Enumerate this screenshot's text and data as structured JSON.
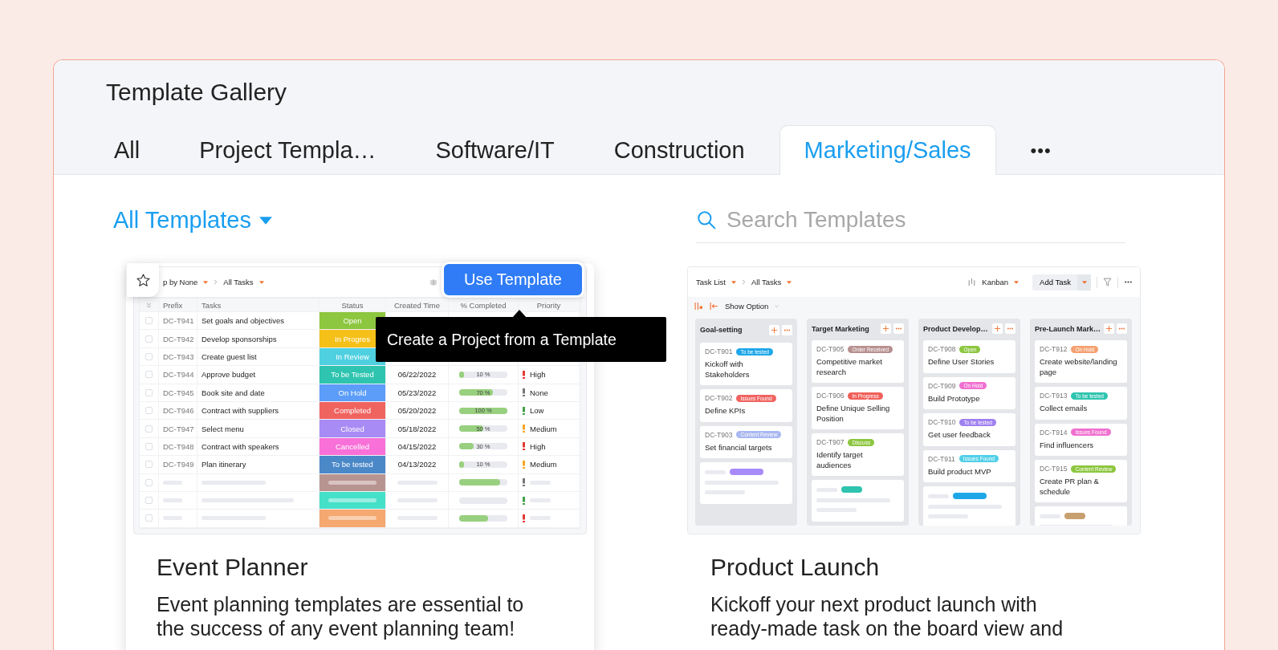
{
  "page_title": "Template Gallery",
  "tabs": [
    {
      "label": "All",
      "selected": false
    },
    {
      "label": "Project Templa…",
      "selected": false
    },
    {
      "label": "Software/IT",
      "selected": false
    },
    {
      "label": "Construction",
      "selected": false
    },
    {
      "label": "Marketing/Sales",
      "selected": true
    },
    {
      "label": "•••",
      "selected": false
    }
  ],
  "filter": {
    "label": "All Templates"
  },
  "search": {
    "placeholder": "Search Templates"
  },
  "templates": [
    {
      "kind": "table",
      "hovered": true,
      "title": "Event Planner",
      "description": "Event planning templates are essential to the success of any event planning team!",
      "use_button": "Use Template",
      "tooltip": "Create a Project from a Template",
      "preview": {
        "breadcrumb": [
          "p by None",
          "All Tasks"
        ],
        "columns": [
          "Prefix",
          "Tasks",
          "Status",
          "Created Time",
          "% Completed",
          "Priority"
        ],
        "rows": [
          {
            "kind": "task",
            "checked": false,
            "prefix": "DC-T941",
            "task": "Set goals and objectives",
            "status": {
              "label": "Open",
              "color": "#8dc63f"
            }
          },
          {
            "kind": "task",
            "checked": false,
            "prefix": "DC-T942",
            "task": "Develop sponsorships",
            "status": {
              "label": "In Progres",
              "color": "#f5c018"
            }
          },
          {
            "kind": "task",
            "checked": false,
            "prefix": "DC-T943",
            "task": "Create guest list",
            "status": {
              "label": "In Review",
              "color": "#4fd0e0"
            }
          },
          {
            "kind": "task",
            "checked": false,
            "prefix": "DC-T944",
            "task": "Approve budget",
            "status": {
              "label": "To be Tested",
              "color": "#2ec4b0"
            },
            "created": "06/22/2022",
            "progress": {
              "label": "10 %",
              "level": 0.1
            },
            "priority": {
              "label": "High",
              "color": "#e53935"
            }
          },
          {
            "kind": "task",
            "checked": false,
            "prefix": "DC-T945",
            "task": "Book site and date",
            "status": {
              "label": "On Hold",
              "color": "#5b9df9"
            },
            "created": "05/23/2022",
            "progress": {
              "label": "70 %",
              "level": 0.7
            },
            "priority": {
              "label": "None",
              "color": "#777777"
            }
          },
          {
            "kind": "task",
            "checked": false,
            "prefix": "DC-T946",
            "task": "Contract with suppliers",
            "status": {
              "label": "Completed",
              "color": "#f06460"
            },
            "created": "05/20/2022",
            "progress": {
              "label": "100 %",
              "level": 1
            },
            "priority": {
              "label": "Low",
              "color": "#43a047"
            }
          },
          {
            "kind": "task",
            "checked": false,
            "prefix": "DC-T947",
            "task": "Select menu",
            "status": {
              "label": "Closed",
              "color": "#a98bf5"
            },
            "created": "05/18/2022",
            "progress": {
              "label": "50 %",
              "level": 0.5
            },
            "priority": {
              "label": "Medium",
              "color": "#f5a623"
            }
          },
          {
            "kind": "task",
            "checked": false,
            "prefix": "DC-T948",
            "task": "Contract with speakers",
            "status": {
              "label": "Cancelled",
              "color": "#f870d8"
            },
            "created": "04/15/2022",
            "progress": {
              "label": "30 %",
              "level": 0.3
            },
            "priority": {
              "label": "High",
              "color": "#e53935"
            }
          },
          {
            "kind": "task",
            "checked": false,
            "prefix": "DC-T949",
            "task": "Plan itinerary",
            "status": {
              "label": "To be tested",
              "color": "#4a88c8"
            },
            "created": "04/13/2022",
            "progress": {
              "label": "10 %",
              "level": 0.1
            },
            "priority": {
              "label": "Medium",
              "color": "#f5a623"
            }
          },
          {
            "kind": "placeholder",
            "checked": false,
            "status": {
              "color": "#b89490"
            },
            "progress": {
              "level": 0.85
            },
            "priority": {
              "color": "#777777"
            }
          },
          {
            "kind": "placeholder",
            "checked": false,
            "status": {
              "color": "#45e0c8"
            },
            "progress": {
              "level": 0
            },
            "priority": {
              "color": "#43a047"
            }
          },
          {
            "kind": "placeholder",
            "checked": false,
            "status": {
              "color": "#f5a870"
            },
            "progress": {
              "level": 0.6
            },
            "priority": {
              "color": "#e53935"
            }
          }
        ]
      }
    },
    {
      "kind": "kanban",
      "hovered": false,
      "title": "Product Launch",
      "description": "Kickoff your next product launch with ready-made task on the board view and",
      "preview": {
        "breadcrumb": [
          "Task List",
          "All Tasks"
        ],
        "view": "Kanban",
        "add_button": "Add Task",
        "option": "Show Option",
        "columns": [
          {
            "name": "Goal-setting",
            "cards": [
              {
                "kind": "task",
                "id": "DC-T901",
                "tag": {
                  "label": "To be tested",
                  "color": "#1ea7e8"
                },
                "title": "Kickoff with Stakeholders"
              },
              {
                "kind": "task",
                "id": "DC-T902",
                "tag": {
                  "label": "Issues Found",
                  "color": "#f06460"
                },
                "title": "Define KPIs"
              },
              {
                "kind": "task",
                "id": "DC-T903",
                "tag": {
                  "label": "Content Review",
                  "color": "#a9b8f0"
                },
                "title": "Set financial targets"
              },
              {
                "kind": "placeholder",
                "tag": {
                  "color": "#a78bfa"
                }
              }
            ]
          },
          {
            "name": "Target Marketing",
            "cards": [
              {
                "kind": "task",
                "id": "DC-T905",
                "tag": {
                  "label": "Order Received",
                  "color": "#b89090"
                },
                "title": "Competitive market research"
              },
              {
                "kind": "task",
                "id": "DC-T906",
                "tag": {
                  "label": "In Progress",
                  "color": "#f0605a"
                },
                "title": "Define Unique Selling Position"
              },
              {
                "kind": "task",
                "id": "DC-T907",
                "tag": {
                  "label": "Discuss",
                  "color": "#8cc63f"
                },
                "title": "Identify target audiences"
              },
              {
                "kind": "placeholder",
                "tag": {
                  "color": "#2ec4b0"
                }
              }
            ]
          },
          {
            "name": "Product Develop…",
            "cards": [
              {
                "kind": "task",
                "id": "DC-T908",
                "tag": {
                  "label": "Open",
                  "color": "#8cc63f"
                },
                "title": "Define User Stories"
              },
              {
                "kind": "task",
                "id": "DC-T909",
                "tag": {
                  "label": "On Hold",
                  "color": "#f070d0"
                },
                "title": "Build Prototype"
              },
              {
                "kind": "task",
                "id": "DC-T910",
                "tag": {
                  "label": "To be tested",
                  "color": "#a080f0"
                },
                "title": "Get user feedback"
              },
              {
                "kind": "task",
                "id": "DC-T911",
                "tag": {
                  "label": "Issues Found",
                  "color": "#50d0e8"
                },
                "title": "Build product MVP"
              },
              {
                "kind": "placeholder",
                "tag": {
                  "color": "#1ea7e8"
                }
              }
            ]
          },
          {
            "name": "Pre-Launch Mark…",
            "cards": [
              {
                "kind": "task",
                "id": "DC-T912",
                "tag": {
                  "label": "On Hold",
                  "color": "#f5a070"
                },
                "title": "Create website/landing page"
              },
              {
                "kind": "task",
                "id": "DC-T913",
                "tag": {
                  "label": "To be tested",
                  "color": "#2ec4b0"
                },
                "title": "Collect emails"
              },
              {
                "kind": "task",
                "id": "DC-T914",
                "tag": {
                  "label": "Issues Found",
                  "color": "#f070d0"
                },
                "title": "Find influencers"
              },
              {
                "kind": "task",
                "id": "DC-T915",
                "tag": {
                  "label": "Content Review",
                  "color": "#8cc63f"
                },
                "title": "Create PR plan & schedule"
              },
              {
                "kind": "placeholder",
                "tag": {
                  "color": "#c8a070"
                }
              }
            ]
          }
        ]
      }
    }
  ]
}
